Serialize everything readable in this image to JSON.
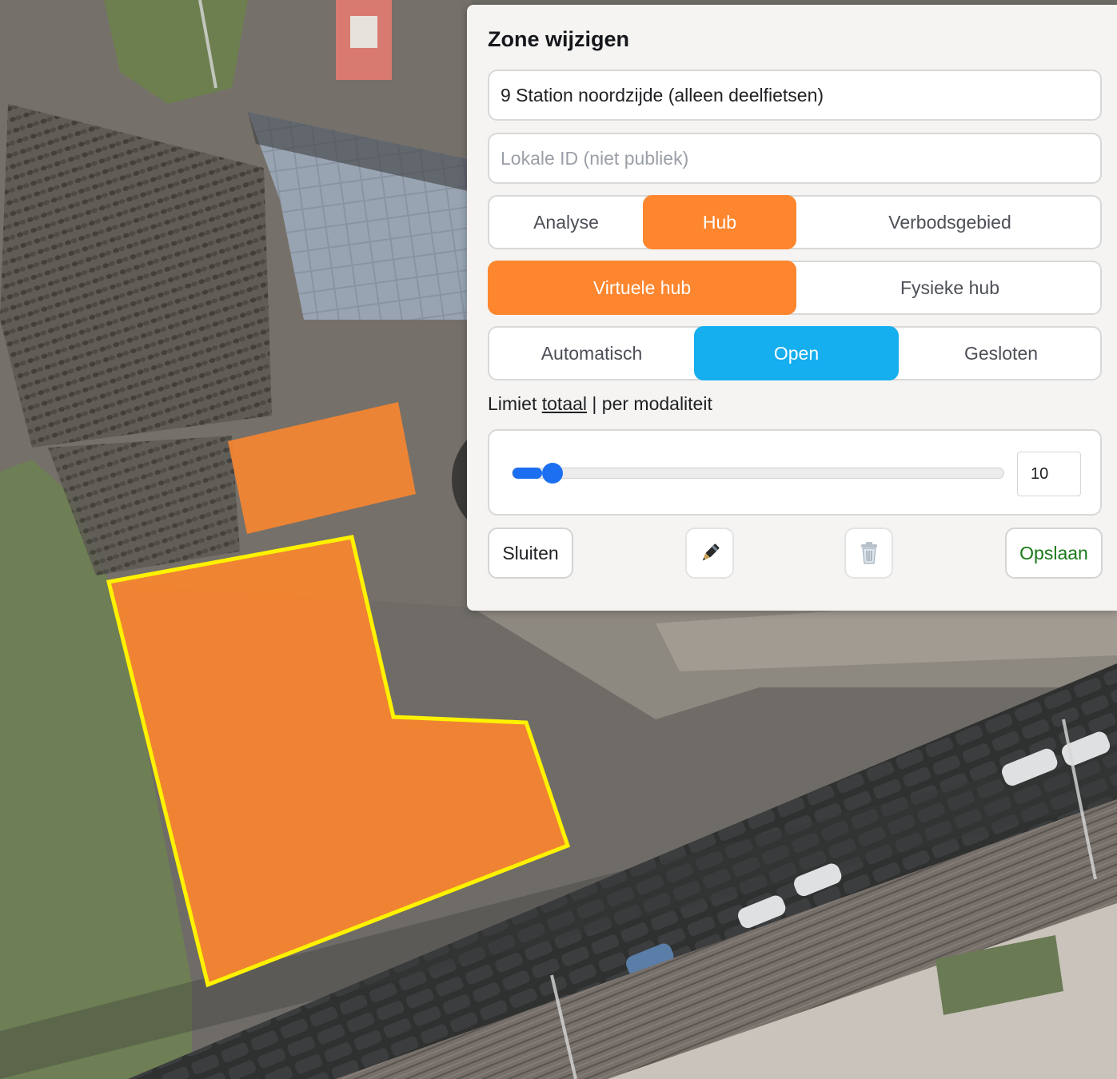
{
  "panel": {
    "title": "Zone wijzigen",
    "name_value": "9 Station noordzijde (alleen deelfietsen)",
    "local_id_value": "",
    "local_id_placeholder": "Lokale ID (niet publiek)"
  },
  "zone_type": {
    "options": [
      "Analyse",
      "Hub",
      "Verbodsgebied"
    ],
    "selected": "Hub"
  },
  "hub_type": {
    "options": [
      "Virtuele hub",
      "Fysieke hub"
    ],
    "selected": "Virtuele hub"
  },
  "hub_state": {
    "options": [
      "Automatisch",
      "Open",
      "Gesloten"
    ],
    "selected": "Open"
  },
  "limit": {
    "prefix": "Limiet",
    "option_total": "totaal",
    "separator": "|",
    "option_per_modality": "per modaliteit",
    "selected": "totaal",
    "value": "10",
    "fraction": 0.06
  },
  "actions": {
    "close_label": "Sluiten",
    "edit_icon": "pen-icon",
    "delete_icon": "trash-icon",
    "save_label": "Opslaan"
  },
  "colors": {
    "accent_orange": "#fd862e",
    "accent_blue": "#15aeef",
    "slider_blue": "#1b6ff0",
    "save_green": "#187a18",
    "zone_outline_selected": "#fff200"
  },
  "map": {
    "zones": [
      {
        "name": "zone-small",
        "selected": false
      },
      {
        "name": "zone-main",
        "selected": true
      }
    ]
  }
}
